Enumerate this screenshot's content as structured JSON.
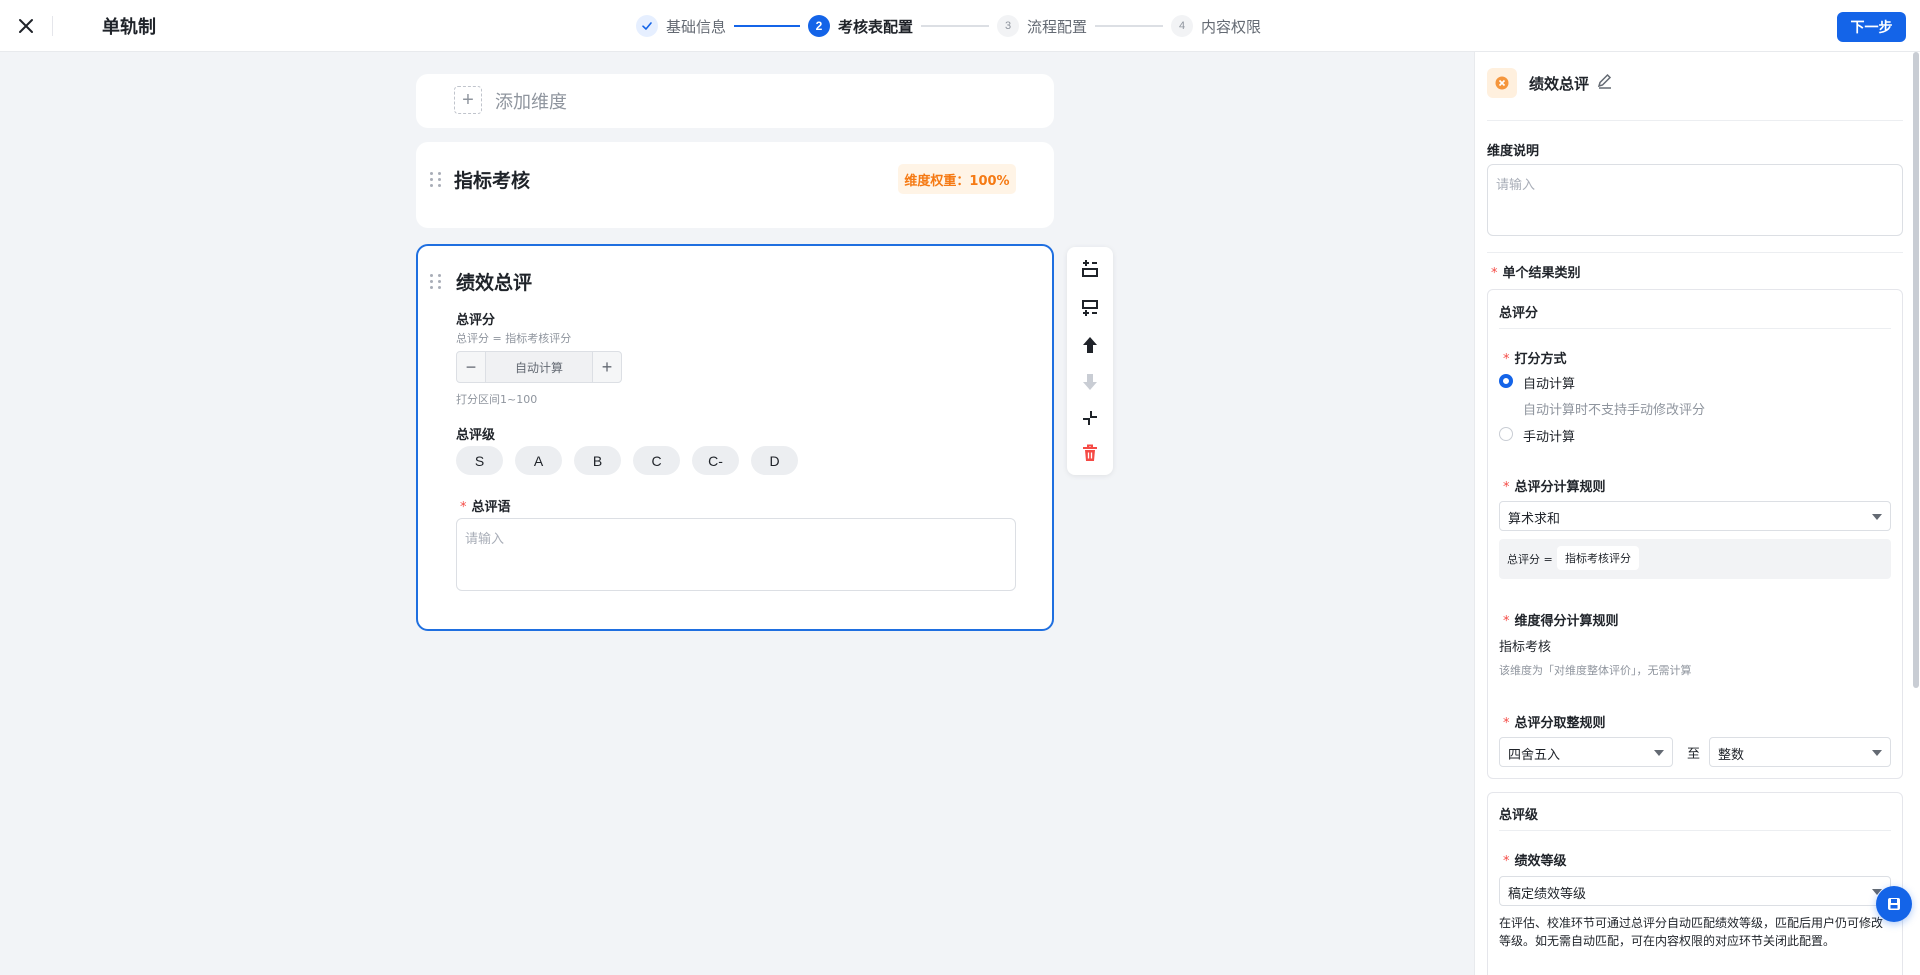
{
  "header": {
    "title": "单轨制",
    "next_label": "下一步",
    "steps": [
      {
        "num": "",
        "label": "基础信息",
        "state": "done"
      },
      {
        "num": "2",
        "label": "考核表配置",
        "state": "active"
      },
      {
        "num": "3",
        "label": "流程配置",
        "state": "pending"
      },
      {
        "num": "4",
        "label": "内容权限",
        "state": "pending"
      }
    ]
  },
  "canvas": {
    "add_dimension": "添加维度",
    "metric_card": {
      "title": "指标考核",
      "weight": "维度权重：100%"
    },
    "perf_card": {
      "title": "绩效总评",
      "score_label": "总评分",
      "score_formula": "总评分 = 指标考核评分",
      "stepper_value": "自动计算",
      "score_range": "打分区间1~100",
      "grade_label": "总评级",
      "grades": [
        "S",
        "A",
        "B",
        "C",
        "C-",
        "D"
      ],
      "comment_label": "总评语",
      "comment_placeholder": "请输入"
    }
  },
  "panel": {
    "title": "绩效总评",
    "desc_label": "维度说明",
    "desc_placeholder": "请输入",
    "result_type_label": "单个结果类别",
    "score_section_title": "总评分",
    "score_method_label": "打分方式",
    "method_auto": "自动计算",
    "method_auto_hint": "自动计算时不支持手动修改评分",
    "method_manual": "手动计算",
    "calc_rule_label": "总评分计算规则",
    "calc_rule_value": "算术求和",
    "formula_prefix": "总评分 =",
    "formula_item": "指标考核评分",
    "dim_rule_label": "维度得分计算规则",
    "dim_rule_item": "指标考核",
    "dim_rule_hint": "该维度为「对维度整体评价」，无需计算",
    "round_rule_label": "总评分取整规则",
    "round_value": "四舍五入",
    "round_to": "至",
    "round_unit": "整数",
    "grade_section_title": "总评级",
    "grade_level_label": "绩效等级",
    "grade_level_value": "稿定绩效等级",
    "grade_hint": "在评估、校准环节可通过总评分自动匹配绩效等级，匹配后用户仍可修改等级。如无需自动匹配，可在内容权限的对应环节关闭此配置。"
  },
  "colors": {
    "primary": "#1464e8",
    "warning": "#f57a14",
    "danger": "#f54a45"
  }
}
